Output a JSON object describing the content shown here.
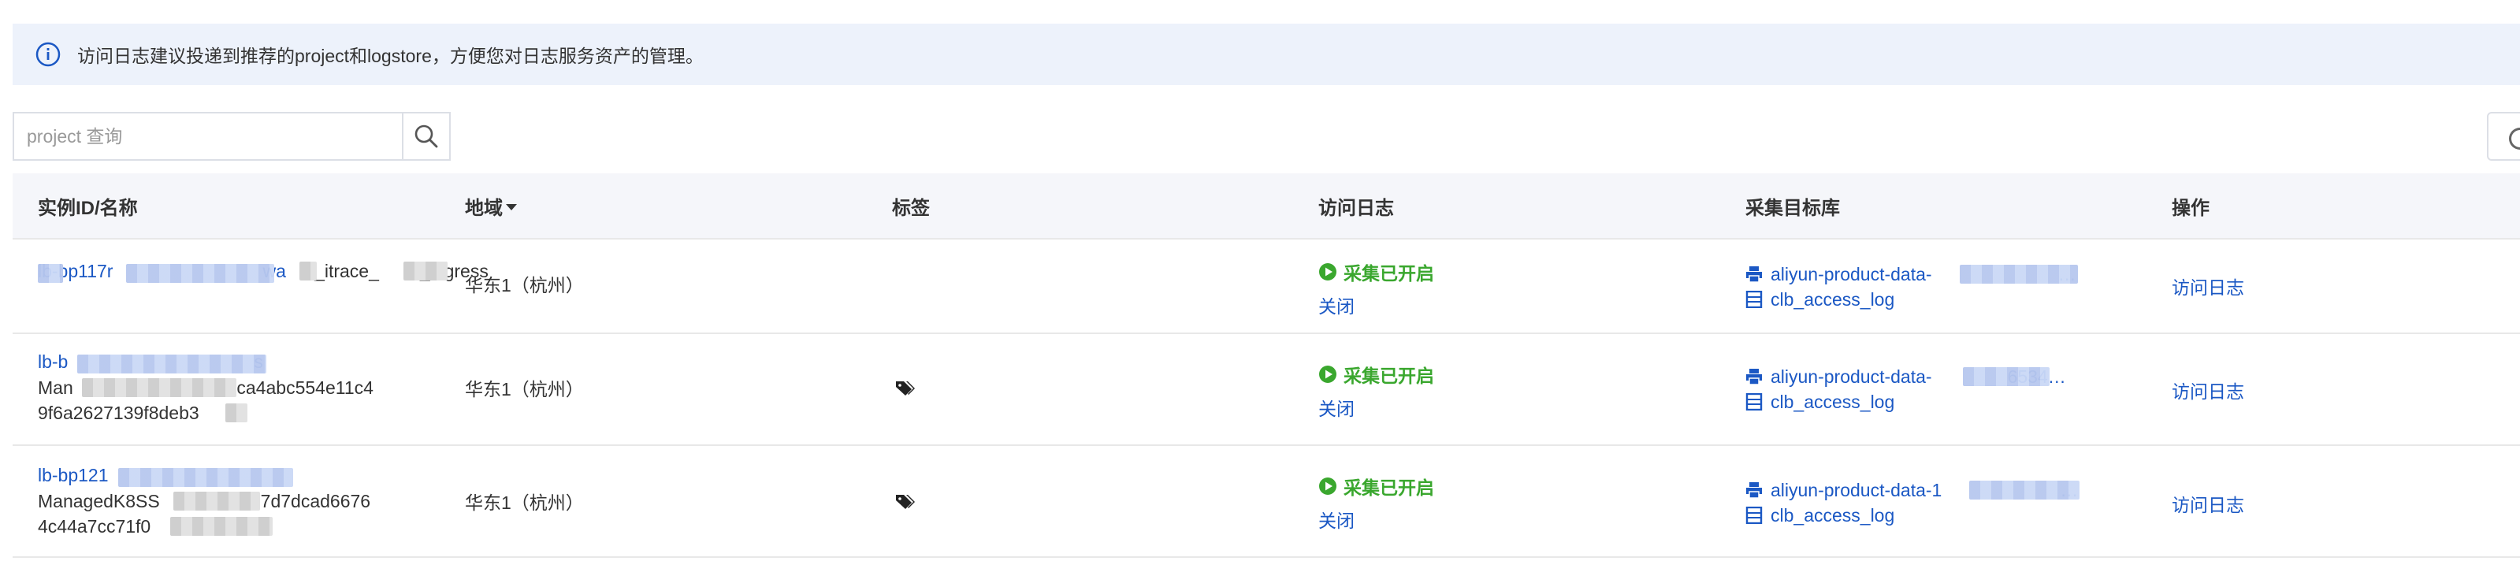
{
  "banner": {
    "text": "访问日志建议投递到推荐的project和logstore，方便您对日志服务资产的管理。"
  },
  "search": {
    "placeholder": "project 查询"
  },
  "table": {
    "headers": {
      "instance": "实例ID/名称",
      "region": "地域",
      "tags": "标签",
      "access_log": "访问日志",
      "target": "采集目标库",
      "actions": "操作"
    },
    "rows": [
      {
        "instance_id": "lb-bp117r",
        "instance_id_tail": "wa",
        "name_lines": [
          "cl_itrace_",
          "_ingress"
        ],
        "region": "华东1（杭州）",
        "has_tag": false,
        "status": "采集已开启",
        "close": "关闭",
        "project": "aliyun-product-data-",
        "project_tail": "…",
        "logstore": "clb_access_log",
        "op": "访问日志"
      },
      {
        "instance_id": "lb-b",
        "instance_id_tail": "s",
        "name_lines": [
          "Man",
          "-ca4abc554e11c4",
          "9f6a2627139f8deb3"
        ],
        "region": "华东1（杭州）",
        "has_tag": true,
        "status": "采集已开启",
        "close": "关闭",
        "project": "aliyun-product-data-",
        "project_tail": "6534…",
        "logstore": "clb_access_log",
        "op": "访问日志"
      },
      {
        "instance_id": "lb-bp121",
        "instance_id_tail": "",
        "name_lines": [
          "ManagedK8SS",
          "-c97d7dcad6676",
          "4c44a7cc71f0"
        ],
        "region": "华东1（杭州）",
        "has_tag": true,
        "status": "采集已开启",
        "close": "关闭",
        "project": "aliyun-product-data-1",
        "project_tail": "…",
        "logstore": "clb_access_log",
        "op": "访问日志"
      }
    ]
  },
  "colors": {
    "link": "#1b58c4",
    "status_green": "#3aa72e",
    "banner_bg": "#edf2fb",
    "header_bg": "#f5f6fa"
  },
  "icons": [
    "info-icon",
    "search-icon",
    "tag-icon",
    "play-circle-icon",
    "printer-icon",
    "database-icon"
  ]
}
